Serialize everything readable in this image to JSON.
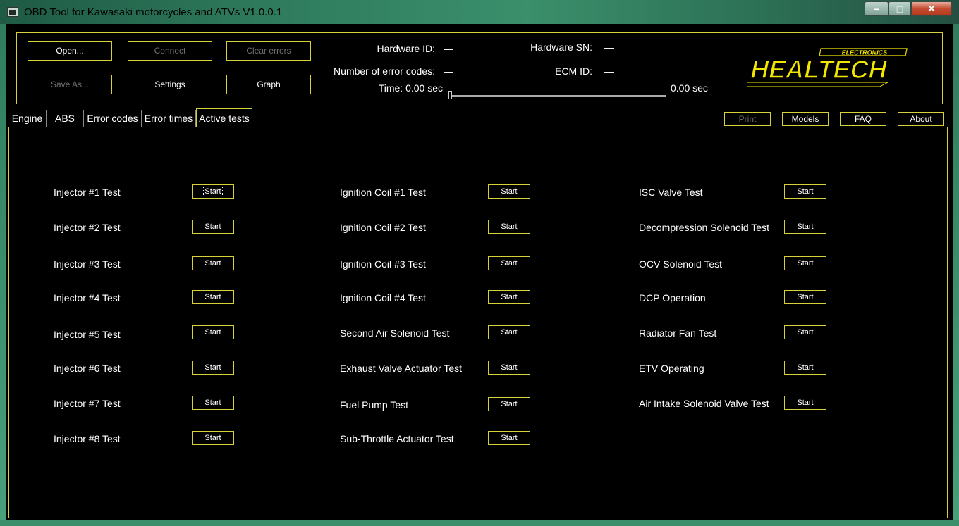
{
  "window": {
    "title": "OBD Tool for Kawasaki motorcycles and ATVs V1.0.0.1",
    "min_glyph": "−",
    "max_glyph": "□",
    "close_glyph": "✕"
  },
  "toolbar": {
    "open_label": "Open...",
    "connect_label": "Connect",
    "clear_errors_label": "Clear errors",
    "save_as_label": "Save As...",
    "settings_label": "Settings",
    "graph_label": "Graph"
  },
  "info": {
    "hardware_id_label": "Hardware ID:",
    "hardware_id_value": "—",
    "hardware_sn_label": "Hardware SN:",
    "hardware_sn_value": "—",
    "error_codes_label": "Number of error codes:",
    "error_codes_value": "—",
    "ecm_id_label": "ECM ID:",
    "ecm_id_value": "—",
    "time_label": "Time: 0.00 sec",
    "time_end_label": "0.00 sec",
    "slider_position": 0
  },
  "logo": {
    "top_text": "ELECTRONICS",
    "main_text": "HEALTECH",
    "color": "#f2e600"
  },
  "tabs": [
    {
      "label": "Engine"
    },
    {
      "label": "ABS"
    },
    {
      "label": "Error codes"
    },
    {
      "label": "Error times"
    },
    {
      "label": "Active tests"
    }
  ],
  "right_buttons": {
    "print_label": "Print",
    "models_label": "Models",
    "faq_label": "FAQ",
    "about_label": "About"
  },
  "tests": {
    "start_label": "Start",
    "col1": [
      "Injector #1 Test",
      "Injector #2 Test",
      "Injector #3 Test",
      "Injector #4 Test",
      "Injector #5 Test",
      "Injector #6 Test",
      "Injector #7 Test",
      "Injector #8 Test"
    ],
    "col2": [
      "Ignition Coil #1 Test",
      "Ignition Coil #2 Test",
      "Ignition Coil #3 Test",
      "Ignition Coil #4 Test",
      "Second Air Solenoid Test",
      "Exhaust Valve Actuator Test",
      "Fuel Pump Test",
      "Sub-Throttle Actuator Test"
    ],
    "col3": [
      "ISC Valve Test",
      "Decompression Solenoid Test",
      "OCV Solenoid Test",
      "DCP Operation",
      "Radiator Fan Test",
      "ETV Operating",
      "Air Intake Solenoid Valve Test"
    ]
  },
  "colors": {
    "accent": "#d8d23a",
    "background": "#000000",
    "disabled_text": "#6f6f6f"
  }
}
